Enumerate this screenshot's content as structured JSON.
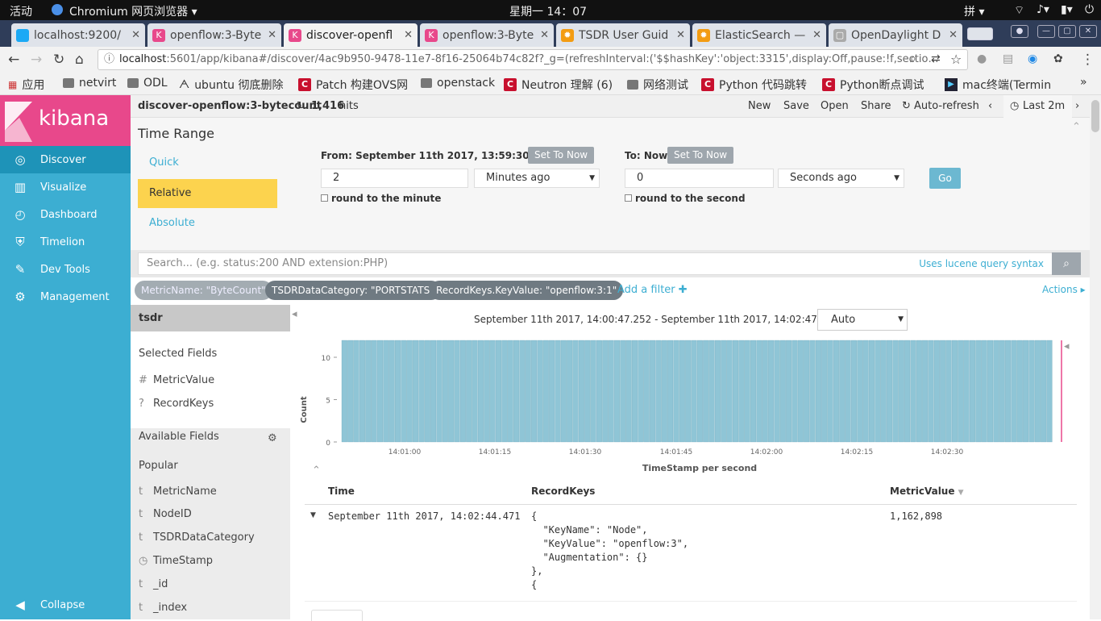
{
  "gnome": {
    "activities": "活动",
    "app": "Chromium 网页浏览器 ▾",
    "clock": "星期一 14：07",
    "ime": "拼 ▾"
  },
  "tabs": [
    {
      "title": "localhost:9200/",
      "fav": "#1ba9f5",
      "glyph": ""
    },
    {
      "title": "openflow:3-Byte",
      "fav": "#e8488b",
      "glyph": "K"
    },
    {
      "title": "discover-openfl",
      "fav": "#e8488b",
      "glyph": "K"
    },
    {
      "title": "openflow:3-Byte",
      "fav": "#e8488b",
      "glyph": "K"
    },
    {
      "title": "TSDR User Guid",
      "fav": "#f39c12",
      "glyph": "✹"
    },
    {
      "title": "ElasticSearch —",
      "fav": "#f39c12",
      "glyph": "✹"
    },
    {
      "title": "OpenDaylight D",
      "fav": "#aaaaaa",
      "glyph": "▢"
    }
  ],
  "address": {
    "host": "localhost",
    "rest": ":5601/app/kibana#/discover/4ac9b950-9478-11e7-8f16-25064b74c82f?_g=(refreshInterval:('$$hashKey':'object:3315',display:Off,pause:!f,sectio…"
  },
  "bookmarks": [
    "应用",
    "netvirt",
    "ODL",
    "ubuntu 彻底删除",
    "Patch 构建OVS网",
    "openstack",
    "Neutron 理解 (6)",
    "网络测试",
    "Python 代码跳转",
    "Python断点调试",
    "mac终端(Termin"
  ],
  "sidebar": {
    "brand": "kibana",
    "items": [
      "Discover",
      "Visualize",
      "Dashboard",
      "Timelion",
      "Dev Tools",
      "Management"
    ],
    "collapse": "Collapse"
  },
  "topbar": {
    "title": "discover-openflow:3-bytecount",
    "hits": "1,416",
    "hits_suffix": "hits",
    "new": "New",
    "save": "Save",
    "open": "Open",
    "share": "Share",
    "autorefresh": "Auto-refresh",
    "range": "Last 2m"
  },
  "timerange": {
    "heading": "Time Range",
    "modes": [
      "Quick",
      "Relative",
      "Absolute"
    ],
    "from_label": "From: September 11th 2017, 13:59:30.967",
    "set_now": "Set To Now",
    "from_value": "2",
    "from_unit": "Minutes ago",
    "round_minute": "round to the minute",
    "to_label": "To: Now",
    "to_value": "0",
    "to_unit": "Seconds ago",
    "round_second": "round to the second",
    "go": "Go"
  },
  "search": {
    "placeholder": "Search... (e.g. status:200 AND extension:PHP)",
    "hint": "Uses lucene query syntax"
  },
  "filters": {
    "pills": [
      "MetricName: \"ByteCount\"",
      "TSDRDataCategory: \"PORTSTATS\"",
      "RecordKeys.KeyValue: \"openflow:3:1\""
    ],
    "add": "Add a filter",
    "actions": "Actions"
  },
  "fieldlist": {
    "index": "tsdr",
    "selected_heading": "Selected Fields",
    "selected": [
      {
        "type": "#",
        "name": "MetricValue"
      },
      {
        "type": "?",
        "name": "RecordKeys"
      }
    ],
    "available_heading": "Available Fields",
    "popular_heading": "Popular",
    "popular": [
      {
        "type": "t",
        "name": "MetricName"
      },
      {
        "type": "t",
        "name": "NodeID"
      },
      {
        "type": "t",
        "name": "TSDRDataCategory"
      },
      {
        "type": "◷",
        "name": "TimeStamp"
      },
      {
        "type": "t",
        "name": "_id"
      },
      {
        "type": "t",
        "name": "_index"
      }
    ]
  },
  "histogram": {
    "range_text": "September 11th 2017, 14:00:47.252 - September 11th 2017, 14:02:47.252 —",
    "interval": "Auto"
  },
  "chart_data": {
    "type": "bar",
    "title": "",
    "xlabel": "TimeStamp per second",
    "ylabel": "Count",
    "yticks": [
      "0",
      "5",
      "10"
    ],
    "ylim": [
      0,
      12
    ],
    "xticks": [
      "14:01:00",
      "14:01:15",
      "14:01:30",
      "14:01:45",
      "14:02:00",
      "14:02:15",
      "14:02:30"
    ],
    "bars_count": 120,
    "bar_value": 12,
    "bar_color": "#8fc5d6"
  },
  "table": {
    "headers": [
      "Time",
      "RecordKeys",
      "MetricValue"
    ],
    "row": {
      "time": "September 11th 2017, 14:02:44.471",
      "record": "{\n  \"KeyName\": \"Node\",\n  \"KeyValue\": \"openflow:3\",\n  \"Augmentation\": {}\n},\n{",
      "value": "1,162,898"
    }
  }
}
